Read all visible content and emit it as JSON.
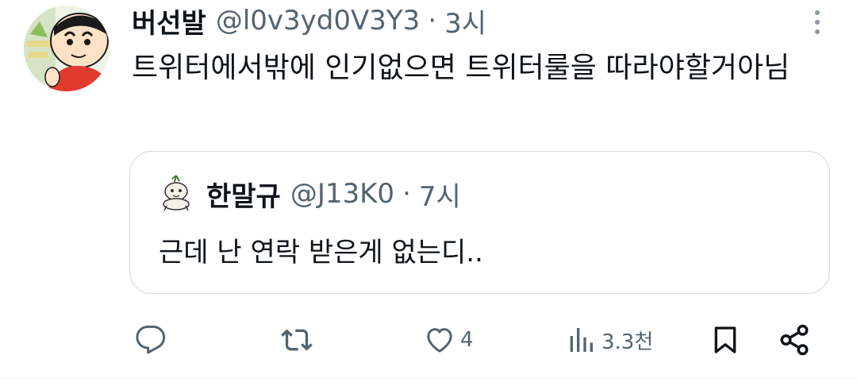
{
  "tweet": {
    "display_name": "버선발",
    "handle": "@l0v3yd0V3Y3",
    "separator": "·",
    "time": "3시",
    "text": "트위터에서밖에 인기없으면 트위터룰을 따라야할거아님",
    "avatar_icon": "crayon-shinchan-avatar-icon"
  },
  "quote": {
    "display_name": "한말규",
    "handle": "@J13K0",
    "separator": "·",
    "time": "7시",
    "text": "근데 난 연락 받은게 없는디..",
    "avatar_icon": "doodle-creature-avatar-icon"
  },
  "actions": {
    "reply": {
      "icon": "reply-icon",
      "count": ""
    },
    "retweet": {
      "icon": "retweet-icon",
      "count": ""
    },
    "like": {
      "icon": "heart-icon",
      "count": "4"
    },
    "views": {
      "icon": "views-icon",
      "count": "3.3천"
    },
    "bookmark": {
      "icon": "bookmark-icon"
    },
    "share": {
      "icon": "share-icon"
    }
  },
  "colors": {
    "text_primary": "#0f1419",
    "text_secondary": "#536471",
    "border": "#cfd9de"
  }
}
